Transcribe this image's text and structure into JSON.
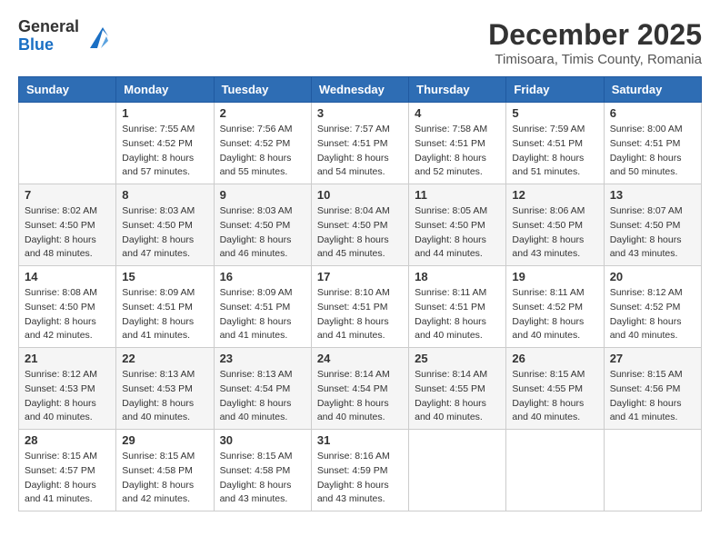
{
  "logo": {
    "general": "General",
    "blue": "Blue"
  },
  "title": "December 2025",
  "location": "Timisoara, Timis County, Romania",
  "days_of_week": [
    "Sunday",
    "Monday",
    "Tuesday",
    "Wednesday",
    "Thursday",
    "Friday",
    "Saturday"
  ],
  "weeks": [
    [
      {
        "day": "",
        "info": ""
      },
      {
        "day": "1",
        "info": "Sunrise: 7:55 AM\nSunset: 4:52 PM\nDaylight: 8 hours\nand 57 minutes."
      },
      {
        "day": "2",
        "info": "Sunrise: 7:56 AM\nSunset: 4:52 PM\nDaylight: 8 hours\nand 55 minutes."
      },
      {
        "day": "3",
        "info": "Sunrise: 7:57 AM\nSunset: 4:51 PM\nDaylight: 8 hours\nand 54 minutes."
      },
      {
        "day": "4",
        "info": "Sunrise: 7:58 AM\nSunset: 4:51 PM\nDaylight: 8 hours\nand 52 minutes."
      },
      {
        "day": "5",
        "info": "Sunrise: 7:59 AM\nSunset: 4:51 PM\nDaylight: 8 hours\nand 51 minutes."
      },
      {
        "day": "6",
        "info": "Sunrise: 8:00 AM\nSunset: 4:51 PM\nDaylight: 8 hours\nand 50 minutes."
      }
    ],
    [
      {
        "day": "7",
        "info": "Sunrise: 8:02 AM\nSunset: 4:50 PM\nDaylight: 8 hours\nand 48 minutes."
      },
      {
        "day": "8",
        "info": "Sunrise: 8:03 AM\nSunset: 4:50 PM\nDaylight: 8 hours\nand 47 minutes."
      },
      {
        "day": "9",
        "info": "Sunrise: 8:03 AM\nSunset: 4:50 PM\nDaylight: 8 hours\nand 46 minutes."
      },
      {
        "day": "10",
        "info": "Sunrise: 8:04 AM\nSunset: 4:50 PM\nDaylight: 8 hours\nand 45 minutes."
      },
      {
        "day": "11",
        "info": "Sunrise: 8:05 AM\nSunset: 4:50 PM\nDaylight: 8 hours\nand 44 minutes."
      },
      {
        "day": "12",
        "info": "Sunrise: 8:06 AM\nSunset: 4:50 PM\nDaylight: 8 hours\nand 43 minutes."
      },
      {
        "day": "13",
        "info": "Sunrise: 8:07 AM\nSunset: 4:50 PM\nDaylight: 8 hours\nand 43 minutes."
      }
    ],
    [
      {
        "day": "14",
        "info": "Sunrise: 8:08 AM\nSunset: 4:50 PM\nDaylight: 8 hours\nand 42 minutes."
      },
      {
        "day": "15",
        "info": "Sunrise: 8:09 AM\nSunset: 4:51 PM\nDaylight: 8 hours\nand 41 minutes."
      },
      {
        "day": "16",
        "info": "Sunrise: 8:09 AM\nSunset: 4:51 PM\nDaylight: 8 hours\nand 41 minutes."
      },
      {
        "day": "17",
        "info": "Sunrise: 8:10 AM\nSunset: 4:51 PM\nDaylight: 8 hours\nand 41 minutes."
      },
      {
        "day": "18",
        "info": "Sunrise: 8:11 AM\nSunset: 4:51 PM\nDaylight: 8 hours\nand 40 minutes."
      },
      {
        "day": "19",
        "info": "Sunrise: 8:11 AM\nSunset: 4:52 PM\nDaylight: 8 hours\nand 40 minutes."
      },
      {
        "day": "20",
        "info": "Sunrise: 8:12 AM\nSunset: 4:52 PM\nDaylight: 8 hours\nand 40 minutes."
      }
    ],
    [
      {
        "day": "21",
        "info": "Sunrise: 8:12 AM\nSunset: 4:53 PM\nDaylight: 8 hours\nand 40 minutes."
      },
      {
        "day": "22",
        "info": "Sunrise: 8:13 AM\nSunset: 4:53 PM\nDaylight: 8 hours\nand 40 minutes."
      },
      {
        "day": "23",
        "info": "Sunrise: 8:13 AM\nSunset: 4:54 PM\nDaylight: 8 hours\nand 40 minutes."
      },
      {
        "day": "24",
        "info": "Sunrise: 8:14 AM\nSunset: 4:54 PM\nDaylight: 8 hours\nand 40 minutes."
      },
      {
        "day": "25",
        "info": "Sunrise: 8:14 AM\nSunset: 4:55 PM\nDaylight: 8 hours\nand 40 minutes."
      },
      {
        "day": "26",
        "info": "Sunrise: 8:15 AM\nSunset: 4:55 PM\nDaylight: 8 hours\nand 40 minutes."
      },
      {
        "day": "27",
        "info": "Sunrise: 8:15 AM\nSunset: 4:56 PM\nDaylight: 8 hours\nand 41 minutes."
      }
    ],
    [
      {
        "day": "28",
        "info": "Sunrise: 8:15 AM\nSunset: 4:57 PM\nDaylight: 8 hours\nand 41 minutes."
      },
      {
        "day": "29",
        "info": "Sunrise: 8:15 AM\nSunset: 4:58 PM\nDaylight: 8 hours\nand 42 minutes."
      },
      {
        "day": "30",
        "info": "Sunrise: 8:15 AM\nSunset: 4:58 PM\nDaylight: 8 hours\nand 43 minutes."
      },
      {
        "day": "31",
        "info": "Sunrise: 8:16 AM\nSunset: 4:59 PM\nDaylight: 8 hours\nand 43 minutes."
      },
      {
        "day": "",
        "info": ""
      },
      {
        "day": "",
        "info": ""
      },
      {
        "day": "",
        "info": ""
      }
    ]
  ]
}
